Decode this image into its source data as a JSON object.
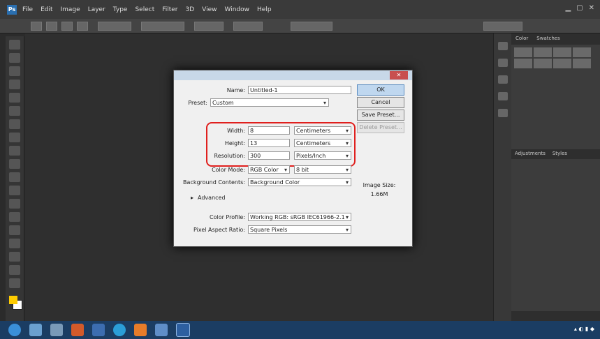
{
  "menubar": {
    "app_logo": "Ps",
    "items": [
      "File",
      "Edit",
      "Image",
      "Layer",
      "Type",
      "Select",
      "Filter",
      "3D",
      "View",
      "Window",
      "Help"
    ]
  },
  "right_panel": {
    "tabs": [
      "Color",
      "Swatches"
    ],
    "layers_tabs": [
      "Adjustments",
      "Styles"
    ]
  },
  "dialog": {
    "name_label": "Name:",
    "name_value": "Untitled-1",
    "preset_label": "Preset:",
    "preset_value": "Custom",
    "width_label": "Width:",
    "width_value": "8",
    "width_unit": "Centimeters",
    "height_label": "Height:",
    "height_value": "13",
    "height_unit": "Centimeters",
    "resolution_label": "Resolution:",
    "resolution_value": "300",
    "resolution_unit": "Pixels/Inch",
    "color_mode_label": "Color Mode:",
    "color_mode_value": "RGB Color",
    "bit_depth_value": "8 bit",
    "bg_label": "Background Contents:",
    "bg_value": "Background Color",
    "advanced_label": "Advanced",
    "color_profile_label": "Color Profile:",
    "color_profile_value": "Working RGB: sRGB IEC61966-2.1",
    "pixel_aspect_label": "Pixel Aspect Ratio:",
    "pixel_aspect_value": "Square Pixels",
    "ok_label": "OK",
    "cancel_label": "Cancel",
    "save_preset_label": "Save Preset...",
    "delete_preset_label": "Delete Preset...",
    "image_size_label": "Image Size:",
    "image_size_value": "1.66M"
  }
}
